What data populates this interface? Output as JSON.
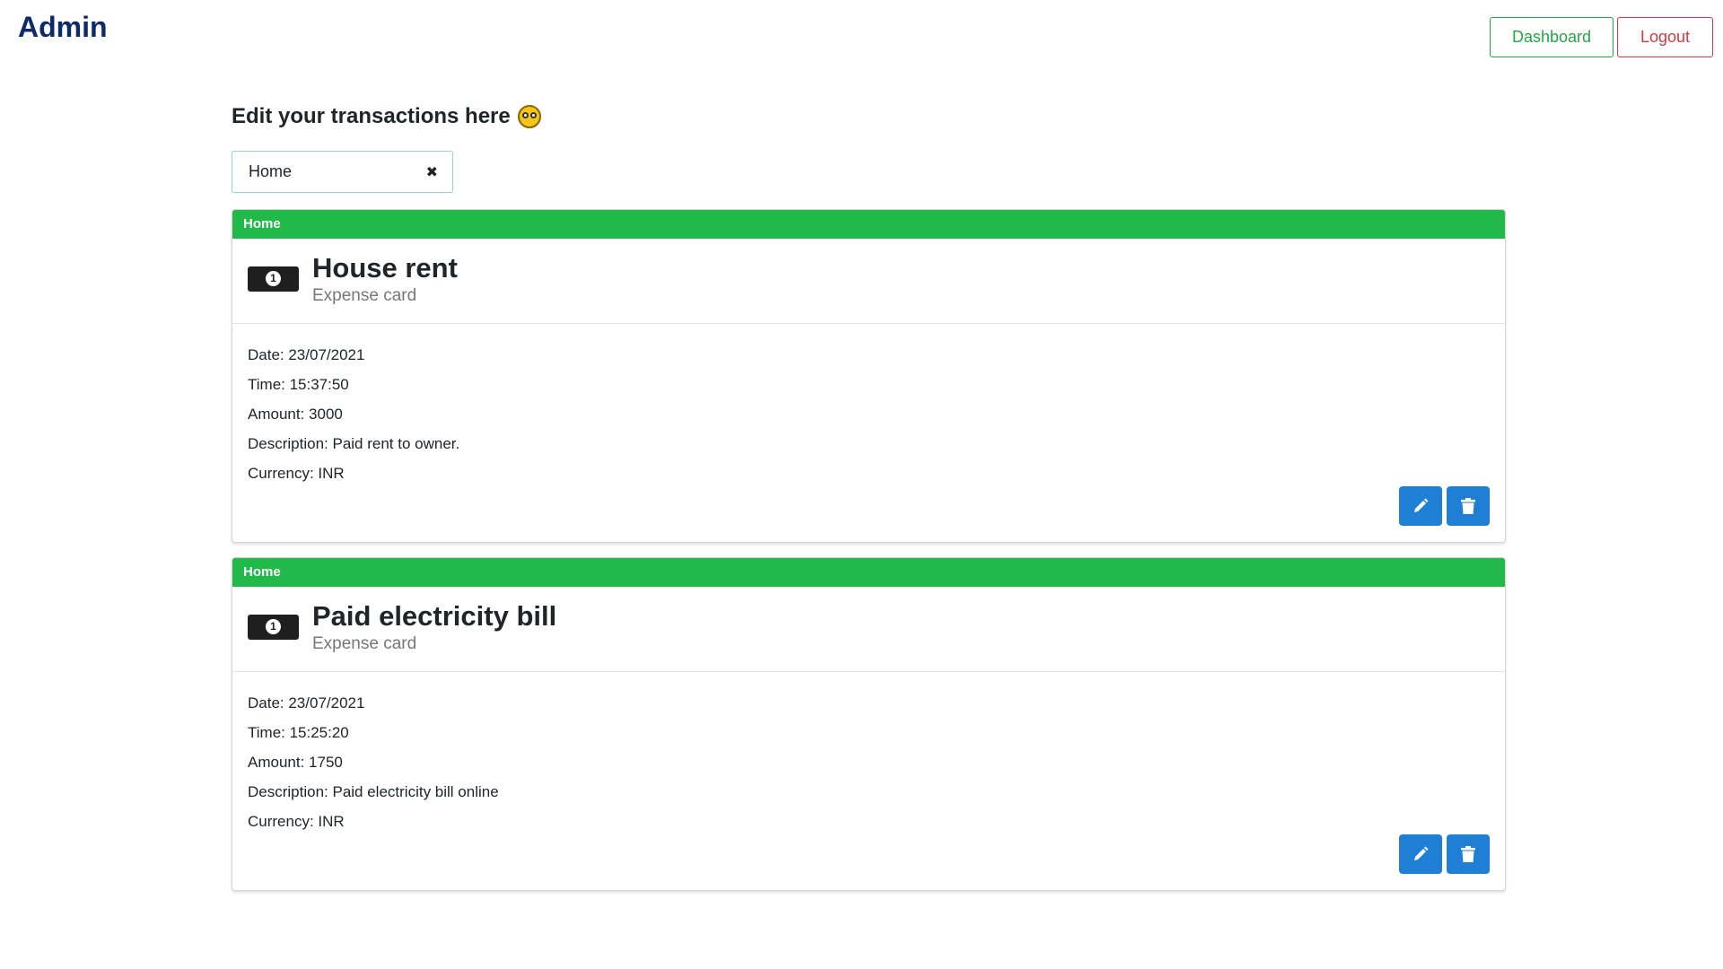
{
  "header": {
    "brand": "Admin",
    "dashboard_label": "Dashboard",
    "logout_label": "Logout"
  },
  "main": {
    "heading": "Edit your transactions here",
    "filter": {
      "value": "Home"
    },
    "cards": [
      {
        "category": "Home",
        "title": "House rent",
        "subtitle": "Expense card",
        "date": "Date: 23/07/2021",
        "time": "Time: 15:37:50",
        "amount": "Amount: 3000",
        "description": "Description: Paid rent to owner.",
        "currency": "Currency: INR"
      },
      {
        "category": "Home",
        "title": "Paid electricity bill",
        "subtitle": "Expense card",
        "date": "Date: 23/07/2021",
        "time": "Time: 15:25:20",
        "amount": "Amount: 1750",
        "description": "Description: Paid electricity bill online",
        "currency": "Currency: INR"
      }
    ]
  },
  "icons": {
    "heading_emoji": "flushed-face-icon",
    "filter_clear": "close-icon",
    "card_icon": "money-bill-icon",
    "edit": "pencil-icon",
    "delete": "trash-icon"
  },
  "colors": {
    "brand": "#0d2a6b",
    "dashboard": "#22a845",
    "logout": "#dc3545",
    "ribbon": "#21b94a",
    "action_button": "#1f7fd4"
  }
}
